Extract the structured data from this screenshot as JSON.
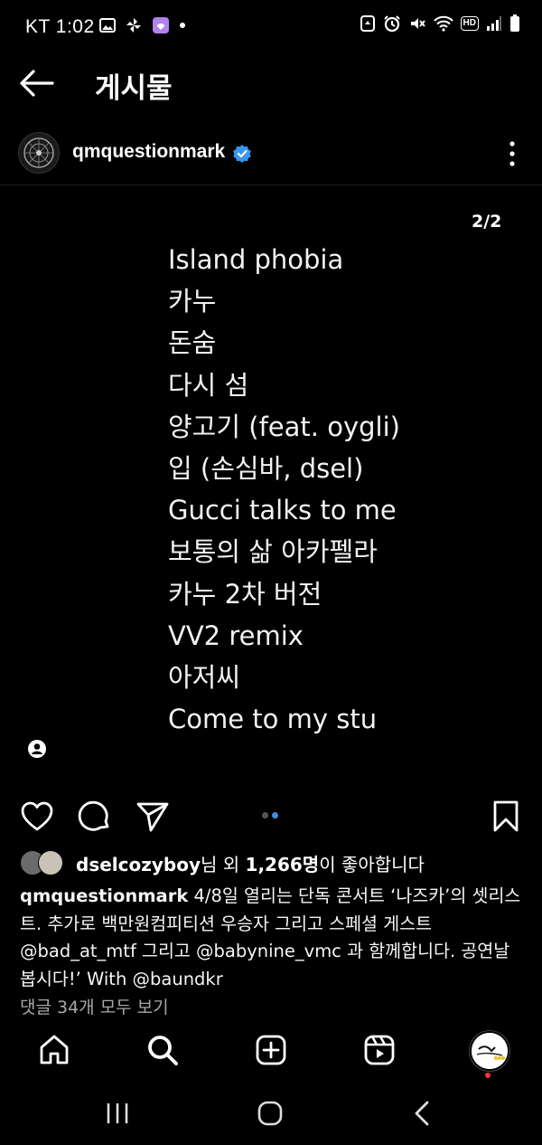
{
  "status_bar": {
    "carrier_time": "KT 1:02",
    "left_icons": [
      "gallery-icon",
      "pinwheel-icon",
      "messenger-icon",
      "dot-icon"
    ],
    "right_icons": [
      "recycle-icon",
      "alarm-icon",
      "mute-icon",
      "wifi-icon",
      "hd-icon",
      "signal-icon",
      "battery-icon"
    ],
    "hd_label": "HD"
  },
  "header": {
    "title": "게시물",
    "back_icon": "arrow-left-icon"
  },
  "post": {
    "username": "qmquestionmark",
    "verified": true,
    "slide_counter": "2/2",
    "setlist": [
      "Island phobia",
      "카누",
      "돈숨",
      "다시 섬",
      "양고기 (feat. oygli)",
      "입 (손심바, dsel)",
      "Gucci talks to me",
      "보통의 삶 아카펠라",
      "카누 2차 버전",
      "VV2 remix",
      "아저씨",
      "Come to my stu"
    ],
    "carousel": {
      "count": 2,
      "active": 2
    },
    "likes": {
      "first_liker": "dselcozyboy",
      "middle": "님 외 ",
      "count": "1,266명",
      "suffix": "이 좋아합니다"
    },
    "caption": {
      "username": "qmquestionmark",
      "text": " 4/8일 열리는 단독 콘서트 ‘나즈카’의 셋리스트. 추가로 백만원컴피티션 우승자 그리고 스페셜 게스트 @bad_at_mtf 그리고 @babynine_vmc 과 함께합니다. 공연날 봅시다!’ With @baundkr"
    },
    "view_comments": "댓글 34개 모두 보기"
  },
  "bottom_nav": [
    "home-icon",
    "search-icon",
    "create-icon",
    "reels-icon",
    "profile-avatar"
  ],
  "system_nav": [
    "recents-icon",
    "home-circle-icon",
    "back-chevron-icon"
  ],
  "colors": {
    "background": "#000000",
    "text": "#ffffff",
    "verified": "#3897f0",
    "active_dot": "#3f8ee8",
    "muted": "#a8a8a8",
    "notif": "#ff3040"
  }
}
